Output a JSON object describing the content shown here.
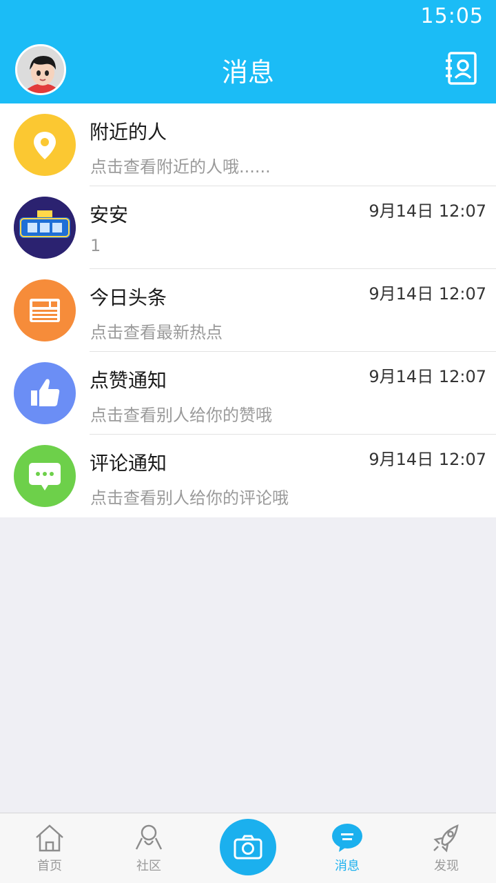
{
  "status_bar": {
    "time": "15:05"
  },
  "header": {
    "title": "消息"
  },
  "messages": [
    {
      "name": "附近的人",
      "preview": "点击查看附近的人哦......",
      "time": "",
      "icon": "location-pin-icon",
      "color": "#fbc832"
    },
    {
      "name": "安安",
      "preview": "1",
      "time": "9月14日 12:07",
      "icon": "avatar-image",
      "color": "#2b2270"
    },
    {
      "name": "今日头条",
      "preview": "点击查看最新热点",
      "time": "9月14日 12:07",
      "icon": "news-icon",
      "color": "#f68c3a"
    },
    {
      "name": "点赞通知",
      "preview": "点击查看别人给你的赞哦",
      "time": "9月14日 12:07",
      "icon": "thumbs-up-icon",
      "color": "#6b8ef5"
    },
    {
      "name": "评论通知",
      "preview": "点击查看别人给你的评论哦",
      "time": "9月14日 12:07",
      "icon": "comment-icon",
      "color": "#6dd04a"
    }
  ],
  "tabbar": {
    "home": "首页",
    "community": "社区",
    "messages": "消息",
    "discover": "发现"
  },
  "colors": {
    "accent": "#1bbcf6",
    "active_tab": "#1bb0ee"
  }
}
